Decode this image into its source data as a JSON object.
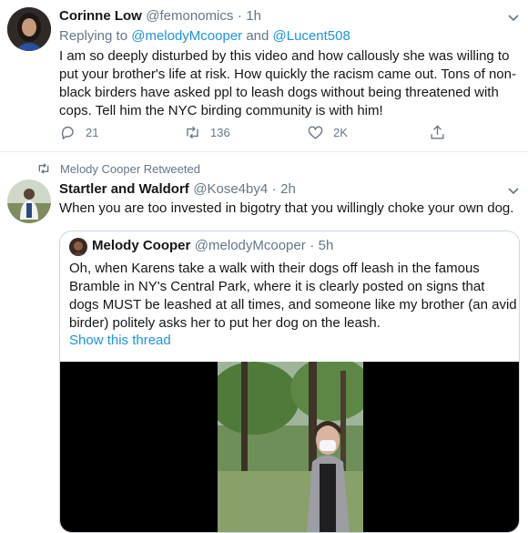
{
  "tweet1": {
    "display_name": "Corinne Low",
    "handle": "@femonomics",
    "time": "1h",
    "replying_prefix": "Replying to",
    "reply_users": [
      "@melodyMcooper",
      "@Lucent508"
    ],
    "reply_and": "and",
    "text": "I am so deeply disturbed by this video and how callously she was willing to put your brother's life at risk. How quickly the racism came out. Tons of non-black birders have asked ppl to leash dogs without being threatened with cops. Tell him the NYC birding community is with him!",
    "reply_count": "21",
    "retweet_count": "136",
    "like_count": "2K"
  },
  "tweet2": {
    "retweeted_by": "Melody Cooper Retweeted",
    "display_name": "Startler and Waldorf",
    "handle": "@Kose4by4",
    "time": "2h",
    "text": "When you are too invested in bigotry that you willingly choke your own dog."
  },
  "quoted": {
    "display_name": "Melody Cooper",
    "handle": "@melodyMcooper",
    "time": "5h",
    "text": "Oh, when Karens take a walk with their dogs off leash in the famous Bramble in NY's Central Park, where it is clearly posted on signs that dogs MUST be leashed at all times, and someone like my brother (an avid birder) politely asks her to put her dog on the leash.",
    "show_thread": "Show this thread"
  },
  "separator": "·",
  "icons": {
    "reply": "reply-icon",
    "retweet": "retweet-icon",
    "like": "like-icon",
    "share": "share-icon",
    "caret": "chevron-down-icon"
  },
  "colors": {
    "link": "#1b95e0",
    "muted": "#657786",
    "text": "#14171a",
    "border": "#e6ecf0"
  }
}
